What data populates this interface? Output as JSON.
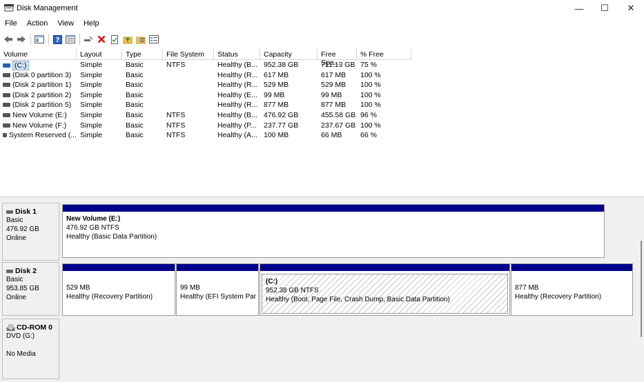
{
  "window": {
    "title": "Disk Management",
    "minimize": "—",
    "maximize": "☐",
    "close": "✕"
  },
  "menu": [
    "File",
    "Action",
    "View",
    "Help"
  ],
  "columns": [
    "Volume",
    "Layout",
    "Type",
    "File System",
    "Status",
    "Capacity",
    "Free Spa...",
    "% Free"
  ],
  "volumes": [
    {
      "volume": "(C:)",
      "layout": "Simple",
      "type": "Basic",
      "fs": "NTFS",
      "status": "Healthy (B...",
      "capacity": "952.38 GB",
      "free": "711.13 GB",
      "pct": "75 %"
    },
    {
      "volume": "(Disk 0 partition 3)",
      "layout": "Simple",
      "type": "Basic",
      "fs": "",
      "status": "Healthy (R...",
      "capacity": "617 MB",
      "free": "617 MB",
      "pct": "100 %"
    },
    {
      "volume": "(Disk 2 partition 1)",
      "layout": "Simple",
      "type": "Basic",
      "fs": "",
      "status": "Healthy (R...",
      "capacity": "529 MB",
      "free": "529 MB",
      "pct": "100 %"
    },
    {
      "volume": "(Disk 2 partition 2)",
      "layout": "Simple",
      "type": "Basic",
      "fs": "",
      "status": "Healthy (E...",
      "capacity": "99 MB",
      "free": "99 MB",
      "pct": "100 %"
    },
    {
      "volume": "(Disk 2 partition 5)",
      "layout": "Simple",
      "type": "Basic",
      "fs": "",
      "status": "Healthy (R...",
      "capacity": "877 MB",
      "free": "877 MB",
      "pct": "100 %"
    },
    {
      "volume": "New Volume (E:)",
      "layout": "Simple",
      "type": "Basic",
      "fs": "NTFS",
      "status": "Healthy (B...",
      "capacity": "476.92 GB",
      "free": "455.58 GB",
      "pct": "96 %"
    },
    {
      "volume": "New Volume (F:)",
      "layout": "Simple",
      "type": "Basic",
      "fs": "NTFS",
      "status": "Healthy (P...",
      "capacity": "237.77 GB",
      "free": "237.67 GB",
      "pct": "100 %"
    },
    {
      "volume": "System Reserved (...",
      "layout": "Simple",
      "type": "Basic",
      "fs": "NTFS",
      "status": "Healthy (A...",
      "capacity": "100 MB",
      "free": "66 MB",
      "pct": "66 %"
    }
  ],
  "disk1": {
    "name": "Disk 1",
    "type": "Basic",
    "size": "476.92 GB",
    "state": "Online",
    "partitions": [
      {
        "name": "New Volume  (E:)",
        "size": "476.92 GB NTFS",
        "status": "Healthy (Basic Data Partition)"
      }
    ]
  },
  "disk2": {
    "name": "Disk 2",
    "type": "Basic",
    "size": "953.85 GB",
    "state": "Online",
    "partitions": [
      {
        "name": "",
        "size": "529 MB",
        "status": "Healthy (Recovery Partition)"
      },
      {
        "name": "",
        "size": "99 MB",
        "status": "Healthy (EFI System Par"
      },
      {
        "name": "(C:)",
        "size": "952.38 GB NTFS",
        "status": "Healthy (Boot, Page File, Crash Dump, Basic Data Partition)"
      },
      {
        "name": "",
        "size": "877 MB",
        "status": "Healthy (Recovery Partition)"
      }
    ]
  },
  "cdrom": {
    "name": "CD-ROM 0",
    "type": "DVD (G:)",
    "state": "No Media"
  },
  "colors": {
    "partition_bar": "#00008b",
    "selection": "#cde6ff",
    "pane_bg": "#f0f0f0"
  }
}
